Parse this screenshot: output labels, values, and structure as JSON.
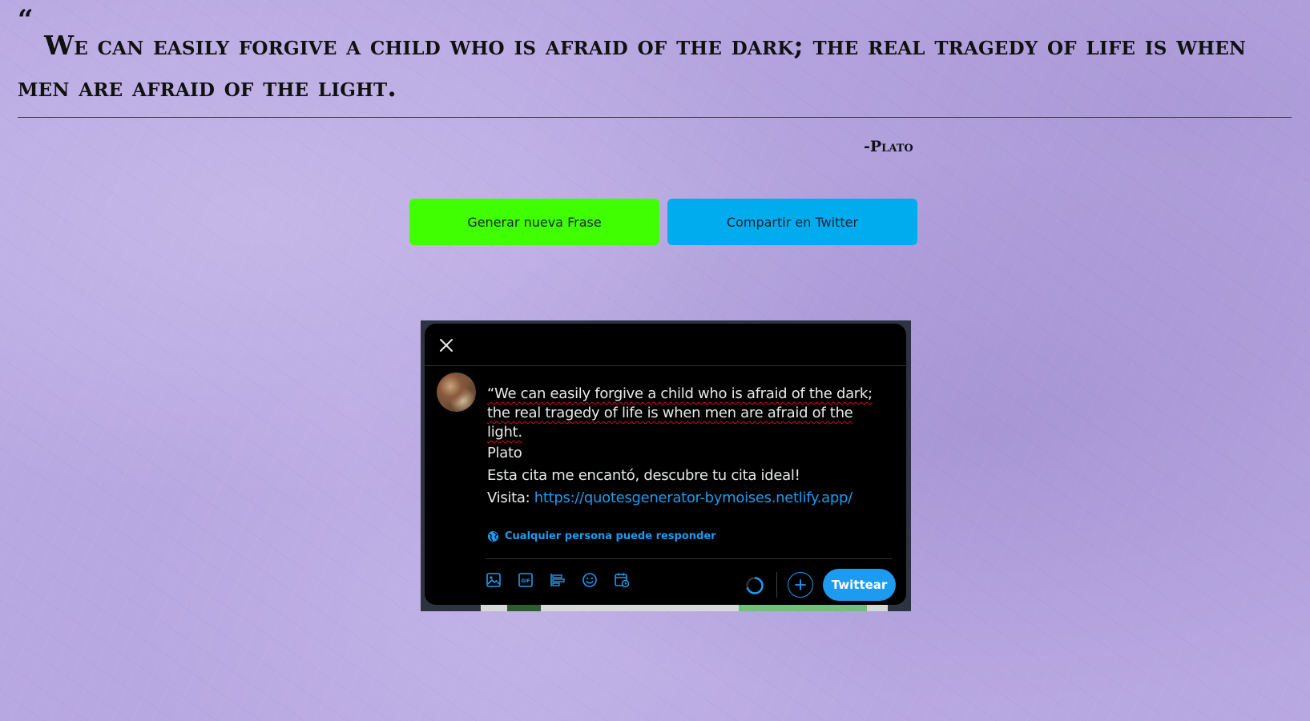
{
  "quote": {
    "open_mark": "“",
    "text": "We can easily forgive a child who is afraid of the dark; the real tragedy of life is when men are afraid of the light.",
    "author": "-Plato"
  },
  "buttons": {
    "new_quote": "Generar nueva Frase",
    "share_twitter": "Compartir en Twitter"
  },
  "tweet_modal": {
    "quote_text": "“We can easily forgive a child who is afraid of the dark; the real tragedy of life is when men are afraid of the light.",
    "author_line": "Plato",
    "message_line": "Esta cita me encantó, descubre tu cita ideal!",
    "visit_label": "Visita: ",
    "link": "https://quotesgenerator-bymoises.netlify.app/",
    "reply_setting": "Cualquier persona puede responder",
    "submit_label": "Twittear",
    "toolbar_icons": [
      "image-icon",
      "gif-icon",
      "poll-icon",
      "emoji-icon",
      "schedule-icon"
    ]
  },
  "colors": {
    "background": "#b8a8e2",
    "new_quote_button": "#40ff00",
    "twitter_button": "#00acee",
    "twitter_blue": "#1d9bf0"
  }
}
